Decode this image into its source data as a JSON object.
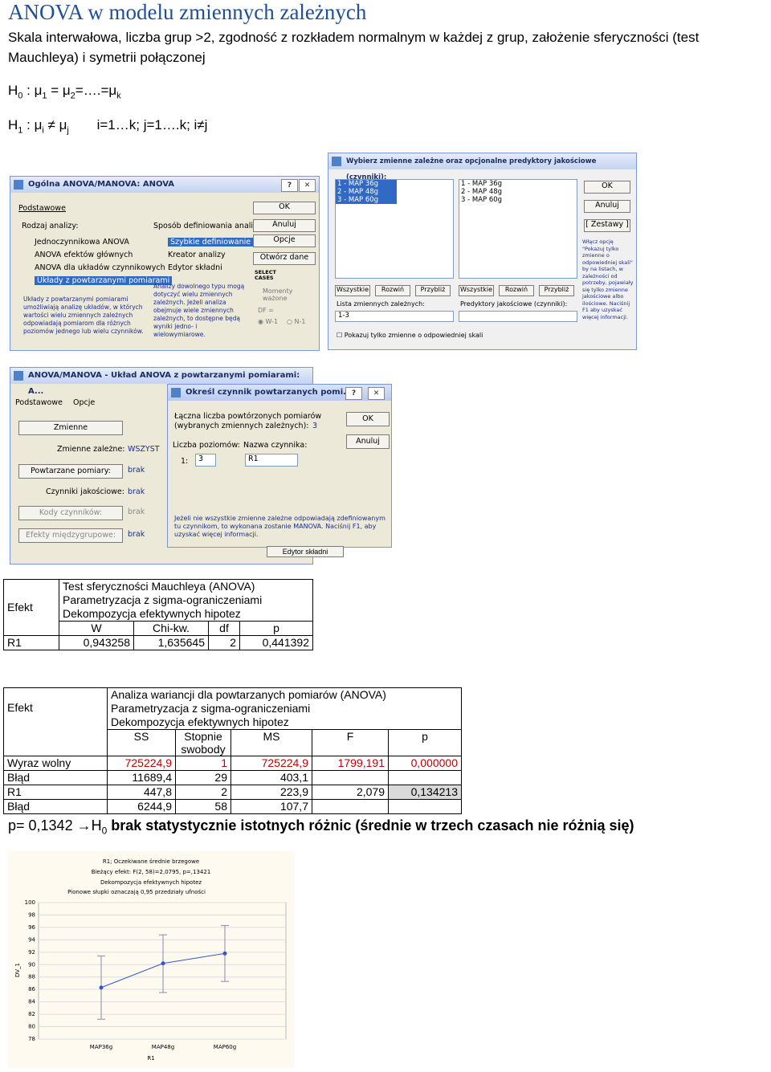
{
  "title": "ANOVA w modelu zmiennych zależnych",
  "subtitle": "Skala interwałowa, liczba grup >2, zgodność z rozkładem normalnym w każdej z grup, założenie sferyczności (test Mauchleya) i symetrii połączonej",
  "h0": {
    "lead": "H",
    "sub": "0",
    "text": " : μ",
    "s1": "1",
    "mid": " = μ",
    "s2": "2",
    "tail": "=….=μ",
    "sk": "k"
  },
  "h1": {
    "lead": "H",
    "sub": "1",
    "text": " : μ",
    "si": "i",
    "neq": " ≠ μ",
    "sj": "j",
    "range": "i=1…k; j=1….k; i≠j"
  },
  "win1": {
    "title": "Ogólna ANOVA/MANOVA: ANOVA",
    "tab": "Podstawowe",
    "group1": "Rodzaj analizy:",
    "analyses": [
      "Jednoczynnikowa ANOVA",
      "ANOVA efektów głównych",
      "ANOVA dla układów czynnikowych",
      "Układy z powtarzanymi pomiarami"
    ],
    "group2": "Sposób definiowania analizy:",
    "methods": [
      "Szybkie definiowanie",
      "Kreator analizy",
      "Edytor składni"
    ],
    "note1": "Układy z powtarzanymi pomiarami umożliwiają analizę układów, w których wartości wielu zmiennych zależnych odpowiadają pomiarom dla różnych poziomów jednego lub wielu czynników.",
    "note2": "Analizy dowolnego typu mogą dotyczyć wielu zmiennych zależnych. Jeżeli analiza obejmuje wiele zmiennych zależnych, to dostępne będą wyniki jedno- i wielowymiarowe.",
    "buttons": [
      "OK",
      "Anuluj",
      "Opcje",
      "Otwórz dane"
    ],
    "select": "SELECT CASES",
    "weights": "Momenty ważone",
    "df": "DF =",
    "radios": [
      "W-1",
      "N-1"
    ]
  },
  "win2": {
    "title": "Wybierz zmienne zależne oraz opcjonalne predyktory jakościowe (czynniki):",
    "list1": [
      "1 - MAP 36g",
      "2 - MAP 48g",
      "3 - MAP 60g"
    ],
    "list2": [
      "1 - MAP 36g",
      "2 - MAP 48g",
      "3 - MAP 60g"
    ],
    "btns": [
      "Wszystkie",
      "Rozwiń",
      "Przybliż",
      "Wszystkie",
      "Rozwiń",
      "Przybliż"
    ],
    "label1": "Lista zmiennych zależnych:",
    "label2": "Predyktory jakościowe (czynniki):",
    "value1": "1-3",
    "checkbox": "Pokazuj tylko zmienne o odpowiedniej skali",
    "ok": "OK",
    "cancel": "Anuluj",
    "sets": "[ Zestawy ]",
    "hint": "Włącz opcję \"Pokazuj tylko zmienne o odpowiedniej skali\" by na listach, w zależności od potrzeby, pojawiały się tylko zmienne jakościowe albo ilościowe. Naciśnij F1 aby uzyskać więcej informacji."
  },
  "win3": {
    "title": "ANOVA/MANOVA - Układ ANOVA z powtarzanymi pomiarami: A...",
    "tabs": [
      "Podstawowe",
      "Opcje"
    ],
    "rows": [
      {
        "btn": "Zmienne",
        "label": "",
        "val": ""
      },
      {
        "btn": "",
        "label": "Zmienne zależne:",
        "val": "WSZYST"
      },
      {
        "btn": "Powtarzane pomiary:",
        "label": "",
        "val": "brak"
      },
      {
        "btn": "",
        "label": "Czynniki jakościowe:",
        "val": "brak"
      },
      {
        "btn": "Kody czynników:",
        "label": "",
        "val": "brak"
      },
      {
        "btn": "Efekty międzygrupowe:",
        "label": "",
        "val": "brak"
      }
    ],
    "editor": "Edytor składni"
  },
  "win4": {
    "title": "Określ czynnik powtarzanych pomi...",
    "total_label": "Łączna liczba powtórzonych pomiarów (wybranych zmiennych zależnych):",
    "total_value": "3",
    "levels_label": "Liczba poziomów:",
    "name_label": "Nazwa czynnika:",
    "row_index": "1:",
    "levels_value": "3",
    "name_value": "R1",
    "ok": "OK",
    "cancel": "Anuluj",
    "note": "Jeżeli nie wszystkie zmienne zależne odpowiadają zdefiniowanym tu czynnikom, to wykonana zostanie MANOVA. Naciśnij F1, aby uzyskać więcej informacji."
  },
  "table1": {
    "effect": "Efekt",
    "heading": [
      "Test sferyczności Mauchleya (ANOVA)",
      "Parametryzacja z sigma-ograniczeniami",
      "Dekompozycja efektywnych hipotez"
    ],
    "cols": [
      "W",
      "Chi-kw.",
      "df",
      "p"
    ],
    "row": {
      "name": "R1",
      "vals": [
        "0,943258",
        "1,635645",
        "2",
        "0,441392"
      ]
    }
  },
  "table2": {
    "effect": "Efekt",
    "heading": [
      "Analiza wariancji dla powtarzanych pomiarów (ANOVA)",
      "Parametryzacja z sigma-ograniczeniami",
      "Dekompozycja efektywnych hipotez"
    ],
    "cols": [
      "SS",
      "Stopnie swobody",
      "MS",
      "F",
      "p"
    ],
    "rows": [
      {
        "name": "Wyraz wolny",
        "vals": [
          "725224,9",
          "1",
          "725224,9",
          "1799,191",
          "0,000000"
        ]
      },
      {
        "name": "Błąd",
        "vals": [
          "11689,4",
          "29",
          "403,1",
          "",
          ""
        ]
      },
      {
        "name": "R1",
        "vals": [
          "447,8",
          "2",
          "223,9",
          "2,079",
          "0,134213"
        ]
      },
      {
        "name": "Błąd",
        "vals": [
          "6244,9",
          "58",
          "107,7",
          "",
          ""
        ]
      }
    ]
  },
  "conclusion": {
    "a": "p= 0,1342 ",
    "arrow": "→",
    "h": "H",
    "sub": "0",
    "b": " brak statystycznie istotnych różnic  (średnie w trzech czasach nie różnią się)"
  },
  "chart_data": {
    "type": "line",
    "title": "R1; Oczekiwane średnie brzegowe",
    "subtitle": [
      "Bieżący efekt: F(2, 58)=2,0795, p=,13421",
      "Dekompozycja efektywnych hipotez",
      "Pionowe słupki oznaczają 0,95 przedziały ufności"
    ],
    "xlabel": "R1",
    "ylabel": "DV_1",
    "categories": [
      "MAP36g",
      "MAP48g",
      "MAP60g"
    ],
    "values": [
      86.3,
      90.2,
      91.8
    ],
    "ci": [
      [
        81.2,
        91.4
      ],
      [
        85.5,
        94.8
      ],
      [
        87.3,
        96.3
      ]
    ],
    "ylim": [
      78,
      100
    ],
    "yticks": [
      "100",
      "98",
      "96",
      "94",
      "92",
      "90",
      "88",
      "86",
      "84",
      "82",
      "80",
      "78"
    ],
    "color": "#3355cc"
  }
}
